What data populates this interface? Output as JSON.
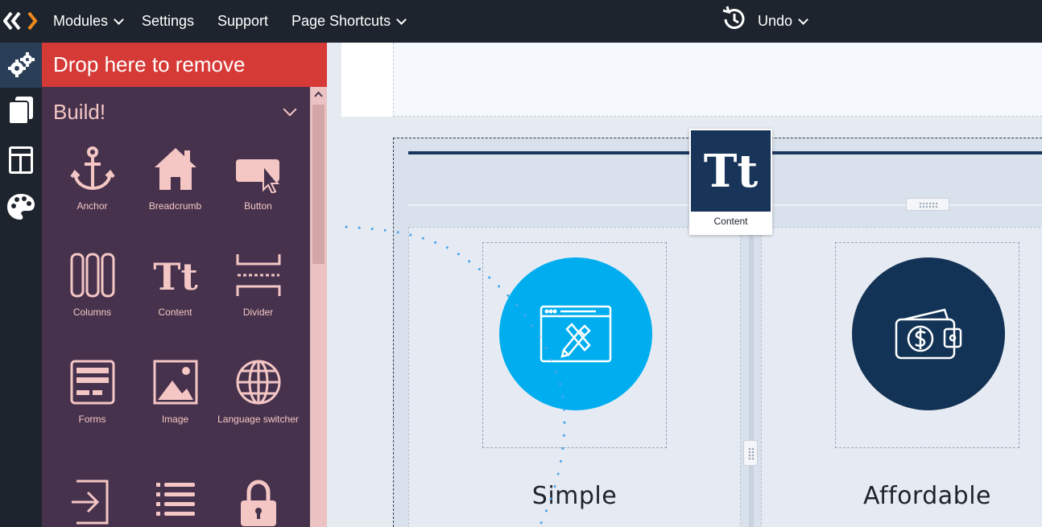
{
  "topbar": {
    "menu": [
      {
        "label": "Modules",
        "has_dropdown": true
      },
      {
        "label": "Settings",
        "has_dropdown": false
      },
      {
        "label": "Support",
        "has_dropdown": false
      },
      {
        "label": "Page Shortcuts",
        "has_dropdown": true
      }
    ],
    "undo_label": "Undo"
  },
  "rail": {
    "items": [
      {
        "icon": "gears-icon",
        "active": true
      },
      {
        "icon": "pages-icon",
        "active": false
      },
      {
        "icon": "layout-icon",
        "active": false
      },
      {
        "icon": "palette-icon",
        "active": false
      }
    ]
  },
  "drawer": {
    "drop_label": "Drop here to remove",
    "title": "Build!",
    "modules": [
      {
        "label": "Anchor",
        "icon": "anchor-icon"
      },
      {
        "label": "Breadcrumb",
        "icon": "home-icon"
      },
      {
        "label": "Button",
        "icon": "button-cursor-icon"
      },
      {
        "label": "Columns",
        "icon": "columns-icon"
      },
      {
        "label": "Content",
        "icon": "text-tt-icon"
      },
      {
        "label": "Divider",
        "icon": "divider-icon"
      },
      {
        "label": "Forms",
        "icon": "form-icon"
      },
      {
        "label": "Image",
        "icon": "image-icon"
      },
      {
        "label": "Language switcher",
        "icon": "globe-icon"
      },
      {
        "label": "",
        "icon": "login-icon"
      },
      {
        "label": "",
        "icon": "list-icon"
      },
      {
        "label": "",
        "icon": "lock-icon"
      }
    ]
  },
  "canvas": {
    "features": [
      {
        "title": "Simple",
        "icon": "browser-tools-icon",
        "color": "#00aeef"
      },
      {
        "title": "Affordable",
        "icon": "wallet-icon",
        "color": "#133356"
      }
    ]
  },
  "drag_ghost": {
    "icon_text": "Tt",
    "label": "Content"
  },
  "colors": {
    "topbar": "#1e242d",
    "drop_bar": "#d63a37",
    "drawer": "#46324c",
    "drawer_text": "#f4c6c4",
    "accent_orange": "#f18a1d"
  }
}
